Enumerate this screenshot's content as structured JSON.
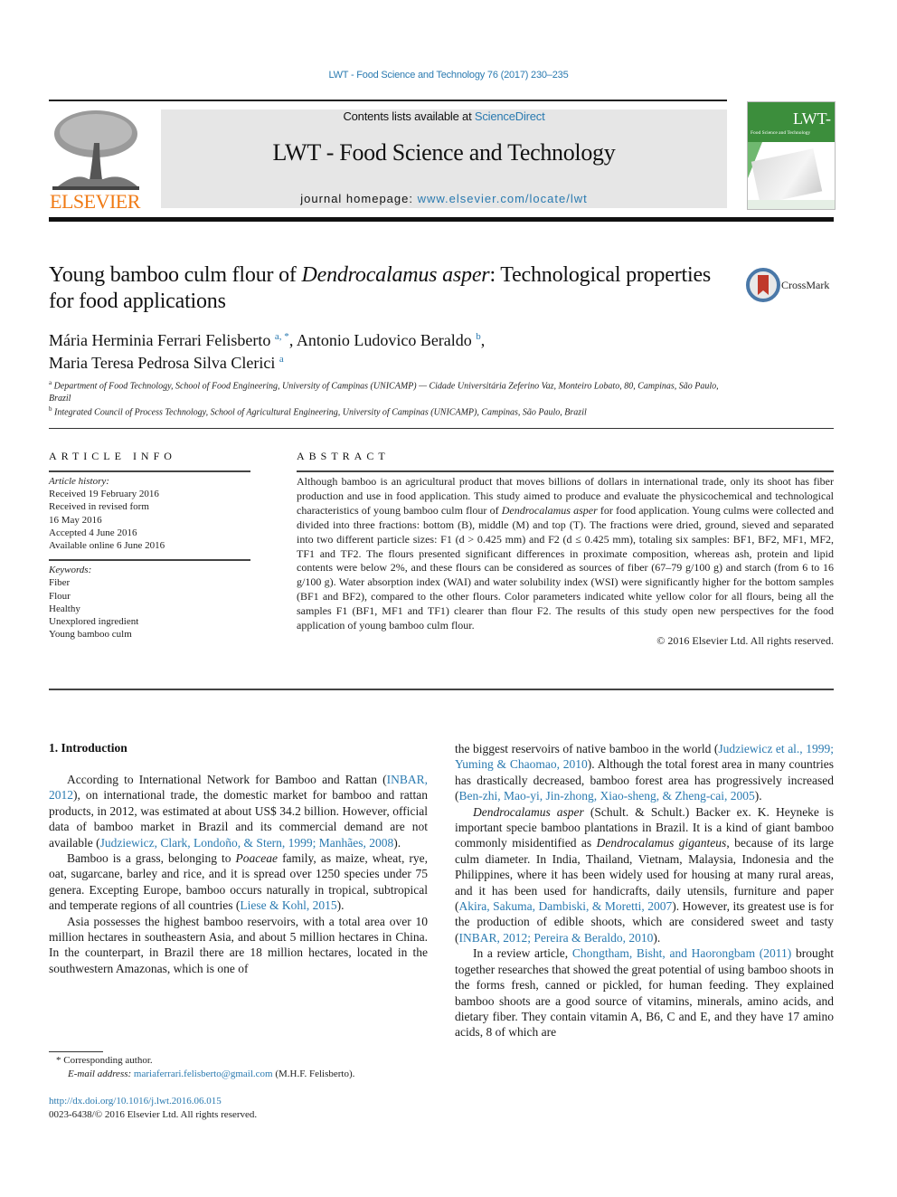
{
  "running_head": "LWT - Food Science and Technology 76 (2017) 230–235",
  "banner": {
    "contents_prefix": "Contents lists available at ",
    "contents_link": "ScienceDirect",
    "journal_title": "LWT - Food Science and Technology",
    "homepage_prefix": "journal homepage: ",
    "homepage_link": "www.elsevier.com/locate/lwt"
  },
  "publisher_logo_text": "ELSEVIER",
  "cover": {
    "title": "LWT-",
    "subtitle": "Food Science and Technology"
  },
  "crossmark_label": "CrossMark",
  "title": {
    "part1": "Young bamboo culm flour of ",
    "italic": "Dendrocalamus asper",
    "part2": ": Technological properties for food applications"
  },
  "authors": [
    {
      "name": "Mária Herminia Ferrari Felisberto",
      "sup": "a, *",
      "sep": ", "
    },
    {
      "name": "Antonio Ludovico Beraldo",
      "sup": "b",
      "sep": ","
    },
    {
      "name": "Maria Teresa Pedrosa Silva Clerici",
      "sup": "a",
      "sep": ""
    }
  ],
  "affiliations": [
    {
      "sup": "a",
      "text": "Department of Food Technology, School of Food Engineering, University of Campinas (UNICAMP) — Cidade Universitária Zeferino Vaz, Monteiro Lobato, 80, Campinas, São Paulo, Brazil"
    },
    {
      "sup": "b",
      "text": "Integrated Council of Process Technology, School of Agricultural Engineering, University of Campinas (UNICAMP), Campinas, São Paulo, Brazil"
    }
  ],
  "article_info": {
    "heading": "ARTICLE INFO",
    "history_label": "Article history:",
    "history": [
      "Received 19 February 2016",
      "Received in revised form",
      "16 May 2016",
      "Accepted 4 June 2016",
      "Available online 6 June 2016"
    ],
    "keywords_label": "Keywords:",
    "keywords": [
      "Fiber",
      "Flour",
      "Healthy",
      "Unexplored ingredient",
      "Young bamboo culm"
    ]
  },
  "abstract": {
    "heading": "ABSTRACT",
    "text_a": "Although bamboo is an agricultural product that moves billions of dollars in international trade, only its shoot has fiber production and use in food application. This study aimed to produce and evaluate the physicochemical and technological characteristics of young bamboo culm flour of ",
    "text_italic": "Dendrocalamus asper",
    "text_b": " for food application. Young culms were collected and divided into three fractions: bottom (B), middle (M) and top (T). The fractions were dried, ground, sieved and separated into two different particle sizes: F1 (d > 0.425 mm) and F2 (d ≤ 0.425 mm), totaling six samples: BF1, BF2, MF1, MF2, TF1 and TF2. The flours presented significant differences in proximate composition, whereas ash, protein and lipid contents were below 2%, and these flours can be considered as sources of fiber (67–79 g/100 g) and starch (from 6 to 16 g/100 g). Water absorption index (WAI) and water solubility index (WSI) were significantly higher for the bottom samples (BF1 and BF2), compared to the other flours. Color parameters indicated white yellow color for all flours, being all the samples F1 (BF1, MF1 and TF1) clearer than flour F2. The results of this study open new perspectives for the food application of young bamboo culm flour.",
    "copyright": "© 2016 Elsevier Ltd. All rights reserved."
  },
  "intro": {
    "heading": "1.  Introduction",
    "p1": {
      "t1": "According to International Network for Bamboo and Rattan (",
      "c1": "INBAR, 2012",
      "t2": "), on international trade, the domestic market for bamboo and rattan products, in 2012, was estimated at about US$ 34.2 billion. However, official data of bamboo market in Brazil and its commercial demand are not available (",
      "c2": "Judziewicz, Clark, Londoño, & Stern, 1999; Manhães, 2008",
      "t3": ")."
    },
    "p2": {
      "t1": "Bamboo is a grass, belonging to ",
      "i1": "Poaceae",
      "t2": " family, as maize, wheat, rye, oat, sugarcane, barley and rice, and it is spread over 1250 species under 75 genera. Excepting Europe, bamboo occurs naturally in tropical, subtropical and temperate regions of all countries (",
      "c1": "Liese & Kohl, 2015",
      "t3": ")."
    },
    "p3": {
      "t1": "Asia possesses the highest bamboo reservoirs, with a total area over 10 million hectares in southeastern Asia, and about 5 million hectares in China. In the counterpart, in Brazil there are 18 million hectares, located in the southwestern Amazonas, which is one of"
    },
    "p4": {
      "t1": "the biggest reservoirs of native bamboo in the world (",
      "c1": "Judziewicz et al., 1999; Yuming & Chaomao, 2010",
      "t2": "). Although the total forest area in many countries has drastically decreased, bamboo forest area has progressively increased (",
      "c2": "Ben-zhi, Mao-yi, Jin-zhong, Xiao-sheng, & Zheng-cai, 2005",
      "t3": ")."
    },
    "p5": {
      "i1": "Dendrocalamus asper",
      "t1": " (Schult. & Schult.) Backer ex. K. Heyneke is important specie bamboo plantations in Brazil. It is a kind of giant bamboo commonly misidentified as ",
      "i2": "Dendrocalamus giganteus",
      "t2": ", because of its large culm diameter. In India, Thailand, Vietnam, Malaysia, Indonesia and the Philippines, where it has been widely used for housing at many rural areas, and it has been used for handicrafts, daily utensils, furniture and paper (",
      "c1": "Akira, Sakuma, Dambiski, & Moretti, 2007",
      "t3": "). However, its greatest use is for the production of edible shoots, which are considered sweet and tasty (",
      "c2": "INBAR, 2012; Pereira & Beraldo, 2010",
      "t4": ")."
    },
    "p6": {
      "t1": "In a review article, ",
      "c1": "Chongtham, Bisht, and Haorongbam (2011)",
      "t2": " brought together researches that showed the great potential of using bamboo shoots in the forms fresh, canned or pickled, for human feeding. They explained bamboo shoots are a good source of vitamins, minerals, amino acids, and dietary fiber. They contain vitamin A, B6, C and E, and they have 17 amino acids, 8 of which are"
    }
  },
  "footnotes": {
    "corresponding": "* Corresponding author.",
    "email_label": "E-mail address: ",
    "email": "mariaferrari.felisberto@gmail.com",
    "email_suffix": " (M.H.F. Felisberto).",
    "doi": "http://dx.doi.org/10.1016/j.lwt.2016.06.015",
    "issn": "0023-6438/© 2016 Elsevier Ltd. All rights reserved."
  }
}
